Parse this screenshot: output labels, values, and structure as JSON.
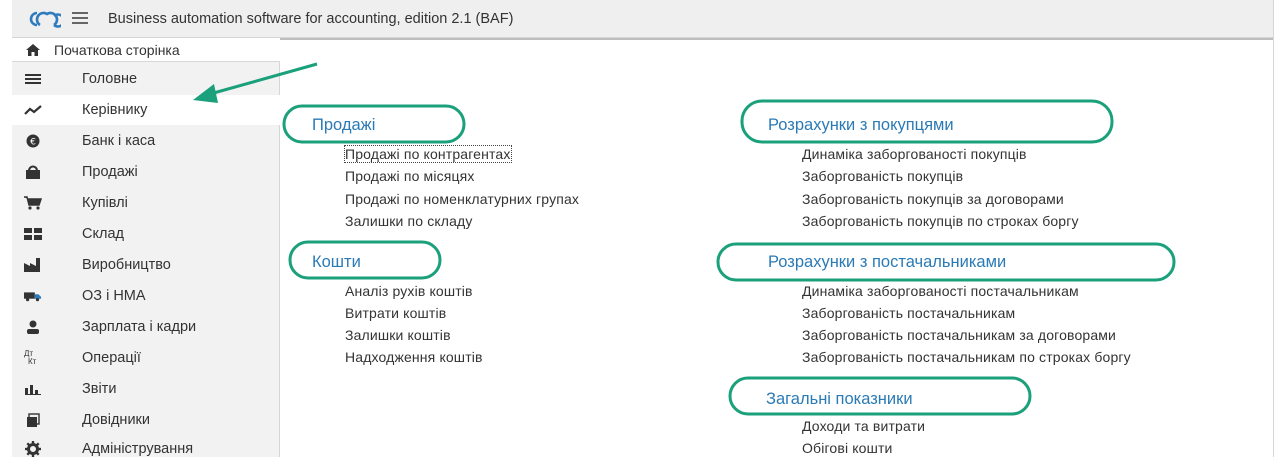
{
  "header": {
    "title": "Business automation software for accounting, edition 2.1  (BAF)"
  },
  "sidebar": {
    "home_label": "Початкова сторінка",
    "sections": [
      {
        "label": "Головне",
        "icon": "hamburger-icon"
      },
      {
        "label": "Керівнику",
        "icon": "trend-icon"
      },
      {
        "label": "Банк і каса",
        "icon": "coin-icon"
      },
      {
        "label": "Продажі",
        "icon": "shopping-bag-icon"
      },
      {
        "label": "Купівлі",
        "icon": "cart-icon"
      },
      {
        "label": "Склад",
        "icon": "warehouse-icon"
      },
      {
        "label": "Виробництво",
        "icon": "factory-icon"
      },
      {
        "label": "ОЗ і НМА",
        "icon": "truck-icon"
      },
      {
        "label": "Зарплата і кадри",
        "icon": "person-icon"
      },
      {
        "label": "Операції",
        "icon": "dt-kt-icon"
      },
      {
        "label": "Звіти",
        "icon": "bar-chart-icon"
      },
      {
        "label": "Довідники",
        "icon": "books-icon"
      },
      {
        "label": "Адміністрування",
        "icon": "gear-icon"
      }
    ],
    "active_index": 1,
    "dt_glyph": "Дт",
    "kt_glyph": "Кт"
  },
  "main": {
    "groups": [
      {
        "title": "Продажі",
        "items": [
          "Продажі по контрагентах",
          "Продажі по місяцях",
          "Продажі по номенклатурних групах",
          "Залишки по складу"
        ]
      },
      {
        "title": "Кошти",
        "items": [
          "Аналіз рухів коштів",
          "Витрати коштів",
          "Залишки коштів",
          "Надходження коштів"
        ]
      },
      {
        "title": "Розрахунки з покупцями",
        "items": [
          "Динаміка заборгованості покупців",
          "Заборгованість покупців",
          "Заборгованість покупців за договорами",
          "Заборгованість покупців по строках боргу"
        ]
      },
      {
        "title": "Розрахунки з постачальниками",
        "items": [
          "Динаміка заборгованості постачальникам",
          "Заборгованість постачальникам",
          "Заборгованість постачальникам за договорами",
          "Заборгованість постачальникам по строках боргу"
        ]
      },
      {
        "title": "Загальні показники",
        "items": [
          "Доходи та витрати",
          "Обігові кошти"
        ]
      }
    ]
  },
  "colors": {
    "accent": "#2a7ab5",
    "highlight": "#1aa07a",
    "logo": "#2f7bbf"
  }
}
